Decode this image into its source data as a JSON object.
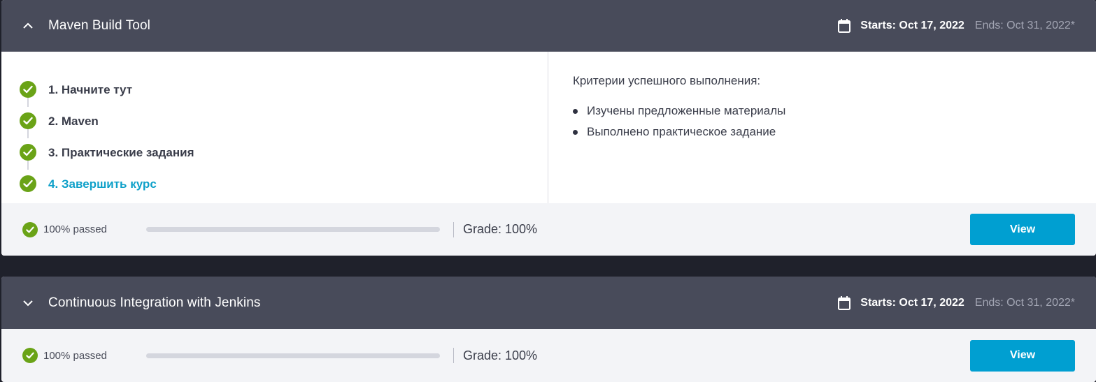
{
  "colors": {
    "header_bg": "#484b5a",
    "page_bg": "#1f212b",
    "success_green": "#6aa317",
    "accent_blue": "#009fd1",
    "active_link": "#0ea0c9"
  },
  "courses": [
    {
      "title": "Maven Build Tool",
      "expanded": true,
      "chevron_icon": "chevron-up-icon",
      "starts": "Starts: Oct 17, 2022",
      "ends": "Ends: Oct 31, 2022*",
      "steps": [
        {
          "label": "1. Начните тут",
          "completed": true
        },
        {
          "label": "2. Maven",
          "completed": true
        },
        {
          "label": "3. Практические задания",
          "completed": true
        },
        {
          "label": "4. Завершить курс",
          "completed": true,
          "active": true
        }
      ],
      "criteria": {
        "title": "Критерии успешного выполнения:",
        "items": [
          "Изучены предложенные материалы",
          "Выполнено практическое задание"
        ]
      },
      "passed_text": "100% passed",
      "progress": 1.0,
      "grade": "Grade: 100%",
      "view_label": "View"
    },
    {
      "title": "Continuous Integration with Jenkins",
      "expanded": false,
      "chevron_icon": "chevron-down-icon",
      "starts": "Starts: Oct 17, 2022",
      "ends": "Ends: Oct 31, 2022*",
      "passed_text": "100% passed",
      "progress": 1.0,
      "grade": "Grade: 100%",
      "view_label": "View"
    }
  ]
}
